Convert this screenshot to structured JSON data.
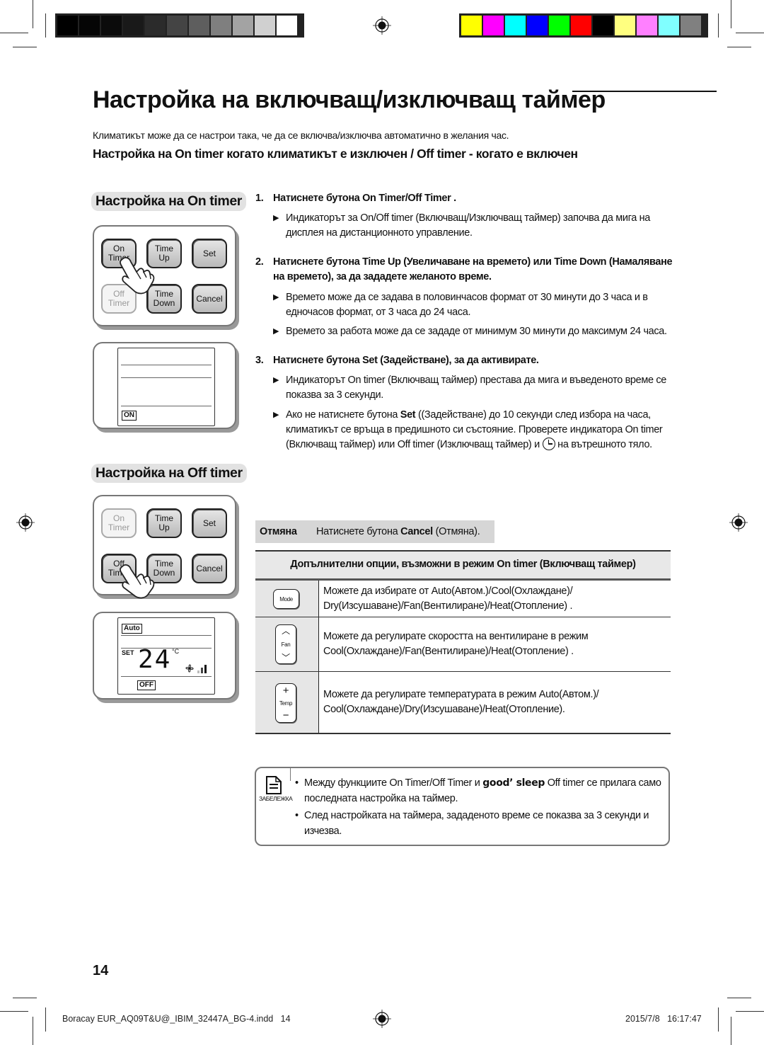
{
  "color_bars": {
    "grayscale": [
      "#000000",
      "#050505",
      "#0b0b0b",
      "#191919",
      "#2b2b2b",
      "#444444",
      "#5e5e5e",
      "#7f7f7f",
      "#a3a3a3",
      "#d0d0d0",
      "#ffffff"
    ],
    "color": [
      "#ffff00",
      "#ff00ff",
      "#00ffff",
      "#0000ff",
      "#00ff00",
      "#ff0000",
      "#000000",
      "#ffff80",
      "#ff80ff",
      "#80ffff",
      "#808080"
    ]
  },
  "page": {
    "title": "Настройка на включващ/изключващ таймер",
    "intro": "Климатикът може да се настрои така, че да се включва/изключва автоматично в желания час.",
    "subheading": "Настройка на On timer когато климатикът е изключен / Off timer - когато е включен",
    "page_number": "14"
  },
  "on_timer_section": {
    "heading": "Настройка на On timer",
    "remote_buttons": [
      {
        "line1": "On",
        "line2": "Timer",
        "state": "pressed"
      },
      {
        "line1": "Time",
        "line2": "Up",
        "state": "active"
      },
      {
        "line1": "Set",
        "line2": "",
        "state": "active"
      },
      {
        "line1": "Off",
        "line2": "Timer",
        "state": "dimmed"
      },
      {
        "line1": "Time",
        "line2": "Down",
        "state": "active"
      },
      {
        "line1": "Cancel",
        "line2": "",
        "state": "active"
      }
    ],
    "display_tag": "ON"
  },
  "off_timer_section": {
    "heading": "Настройка на Off timer",
    "remote_buttons": [
      {
        "line1": "On",
        "line2": "Timer",
        "state": "dimmed"
      },
      {
        "line1": "Time",
        "line2": "Up",
        "state": "active"
      },
      {
        "line1": "Set",
        "line2": "",
        "state": "active"
      },
      {
        "line1": "Off",
        "line2": "Timer",
        "state": "pressed"
      },
      {
        "line1": "Time",
        "line2": "Down",
        "state": "active"
      },
      {
        "line1": "Cancel",
        "line2": "",
        "state": "active"
      }
    ],
    "display": {
      "mode_tag": "Auto",
      "set_label": "SET",
      "temperature": "24",
      "unit": "°C",
      "status_tag": "OFF"
    }
  },
  "steps": [
    {
      "num": "1.",
      "text": "Натиснете бутона On Timer/Off Timer .",
      "bullets": [
        "Индикаторът за On/Off timer (Включващ/Изключващ таймер) започва да мига на дисплея на дистанционното управление."
      ]
    },
    {
      "num": "2.",
      "text": "Натиснете бутона Time Up (Увеличаване на времето) или Time Down (Намаляване на времето), за да зададете желаното време.",
      "bullets": [
        "Времето може да се задава в половинчасов формат от 30 минути до 3 часа и в едночасов формат, от 3 часа до 24 часа.",
        "Времето за работа може да се зададе от минимум 30 минути до максимум 24 часа."
      ]
    },
    {
      "num": "3.",
      "text": "Натиснете бутона Set (Задействане), за да активирате.",
      "bullets": [
        "Индикаторът On timer (Включващ таймер) престава да мига и въведеното време се показва за 3 секунди.",
        {
          "before": "Ако не натиснете бутона ",
          "bold": "Set",
          "after": " ((Задействане) до 10 секунди след избора на часа, климатикът се връща в предишното си състояние. Проверете индикатора On timer (Включващ таймер) или Off timer (Изключващ таймер) и ",
          "icon": "timer-clock-icon",
          "end": " на вътрешното тяло."
        }
      ]
    }
  ],
  "cancel": {
    "label": "Отмяна",
    "text_before": "Натиснете бутона ",
    "text_bold": "Cancel",
    "text_after": " (Отмяна)."
  },
  "options_table": {
    "header": "Допълнителни опции, възможни в режим On timer (Включващ таймер)",
    "rows": [
      {
        "icon": "mode-button-icon",
        "key_label": "Mode",
        "text": "Можете да избирате от Auto(Автом.)/Cool(Охлаждане)/ Dry(Изсушаване)/Fan(Вентилиране)/Heat(Отопление) ."
      },
      {
        "icon": "fan-button-icon",
        "key_label": "Fan",
        "text": "Можете да регулирате скоростта на вентилиране в режим Cool(Охлаждане)/Fan(Вентилиране)/Heat(Отопление) ."
      },
      {
        "icon": "temp-button-icon",
        "key_label": "Temp",
        "text": "Можете да регулирате температурата в режим Auto(Автом.)/ Cool(Охлаждане)/Dry(Изсушаване)/Heat(Отопление)."
      }
    ]
  },
  "note": {
    "label": "ЗАБЕЛЕЖКА",
    "items": [
      {
        "before": "Между функциите On Timer/Off Timer и ",
        "bold": "good’ sleep",
        "after": " Off timer се прилага само последната настройка на таймер."
      },
      {
        "before": "След настройката на таймера, зададеното време се показва за 3 секунди и изчезва.",
        "bold": "",
        "after": ""
      }
    ]
  },
  "footer": {
    "file": "Boracay EUR_AQ09T&U@_IBIM_32447A_BG-4.indd   14",
    "timestamp": "2015/7/8   16:17:47"
  }
}
